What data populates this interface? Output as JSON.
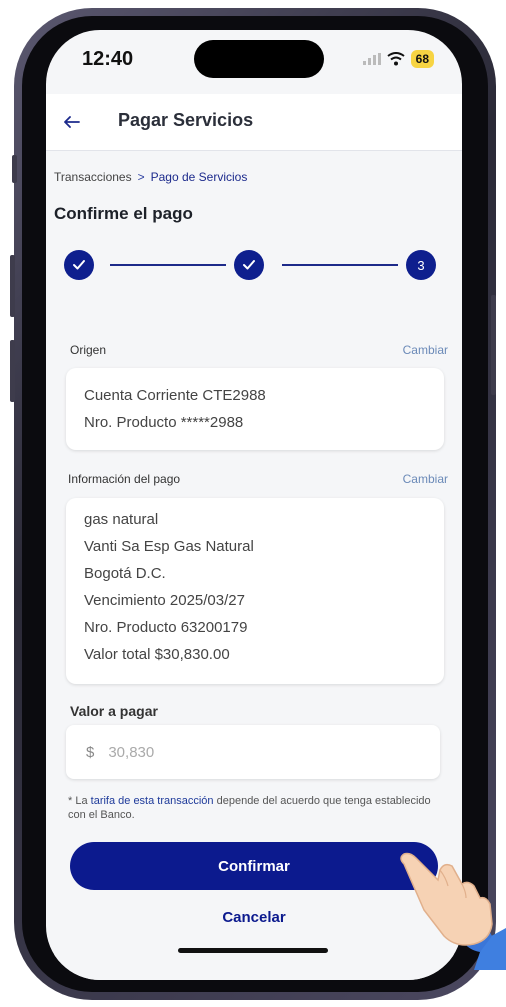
{
  "status_bar": {
    "time": "12:40",
    "battery": "68"
  },
  "header": {
    "title": "Pagar Servicios"
  },
  "breadcrumb": {
    "root": "Transacciones",
    "separator": ">",
    "current": "Pago de Servicios"
  },
  "page_title": "Confirme el pago",
  "stepper": {
    "step3_label": "3"
  },
  "origin": {
    "label": "Origen",
    "change_label": "Cambiar",
    "lines": [
      "Cuenta Corriente CTE2988",
      "Nro. Producto *****2988"
    ]
  },
  "payment_info": {
    "label": "Información del pago",
    "change_label": "Cambiar",
    "lines": [
      "gas natural",
      "Vanti Sa Esp Gas Natural",
      "Bogotá D.C.",
      "Vencimiento 2025/03/27",
      "Nro. Producto 63200179",
      "Valor total $30,830.00"
    ]
  },
  "amount": {
    "label": "Valor a pagar",
    "currency": "$",
    "value": "30,830"
  },
  "note": {
    "prefix": "* La ",
    "link": "tarifa de esta transacción",
    "suffix": " depende del acuerdo que tenga establecido con el Banco."
  },
  "buttons": {
    "confirm": "Confirmar",
    "cancel": "Cancelar"
  },
  "colors": {
    "primary": "#0c1a8e",
    "link": "#6b8ab8",
    "battery": "#f7d443"
  },
  "icons": [
    "back-arrow-icon",
    "check-icon",
    "signal-icon",
    "wifi-icon",
    "pointing-hand-icon"
  ]
}
